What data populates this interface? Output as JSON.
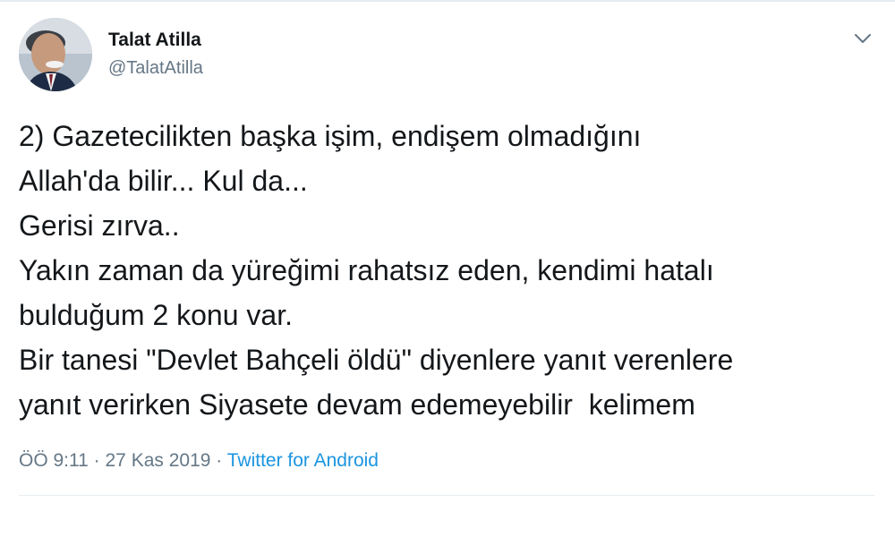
{
  "tweet": {
    "author": {
      "display_name": "Talat Atilla",
      "handle": "@TalatAtilla",
      "avatar_icon": "profile-photo"
    },
    "menu_icon": "chevron-down-icon",
    "text_lines": [
      "2) Gazetecilikten başka işim, endişem olmadığını",
      "Allah'da bilir... Kul da...",
      "Gerisi zırva..",
      "Yakın zaman da yüreğimi rahatsız eden, kendimi hatalı",
      "bulduğum 2 konu var.",
      "Bir tanesi \"Devlet Bahçeli öldü\" diyenlere yanıt verenlere",
      "yanıt verirken Siyasete devam edemeyebilir  kelimem"
    ],
    "meta": {
      "time": "ÖÖ 9:11",
      "separator1": " · ",
      "date": "27 Kas 2019",
      "separator2": " · ",
      "source": "Twitter for Android"
    }
  },
  "colors": {
    "text": "#14171a",
    "secondary": "#657786",
    "link": "#1b95e0",
    "divider": "#e6ecf0"
  }
}
